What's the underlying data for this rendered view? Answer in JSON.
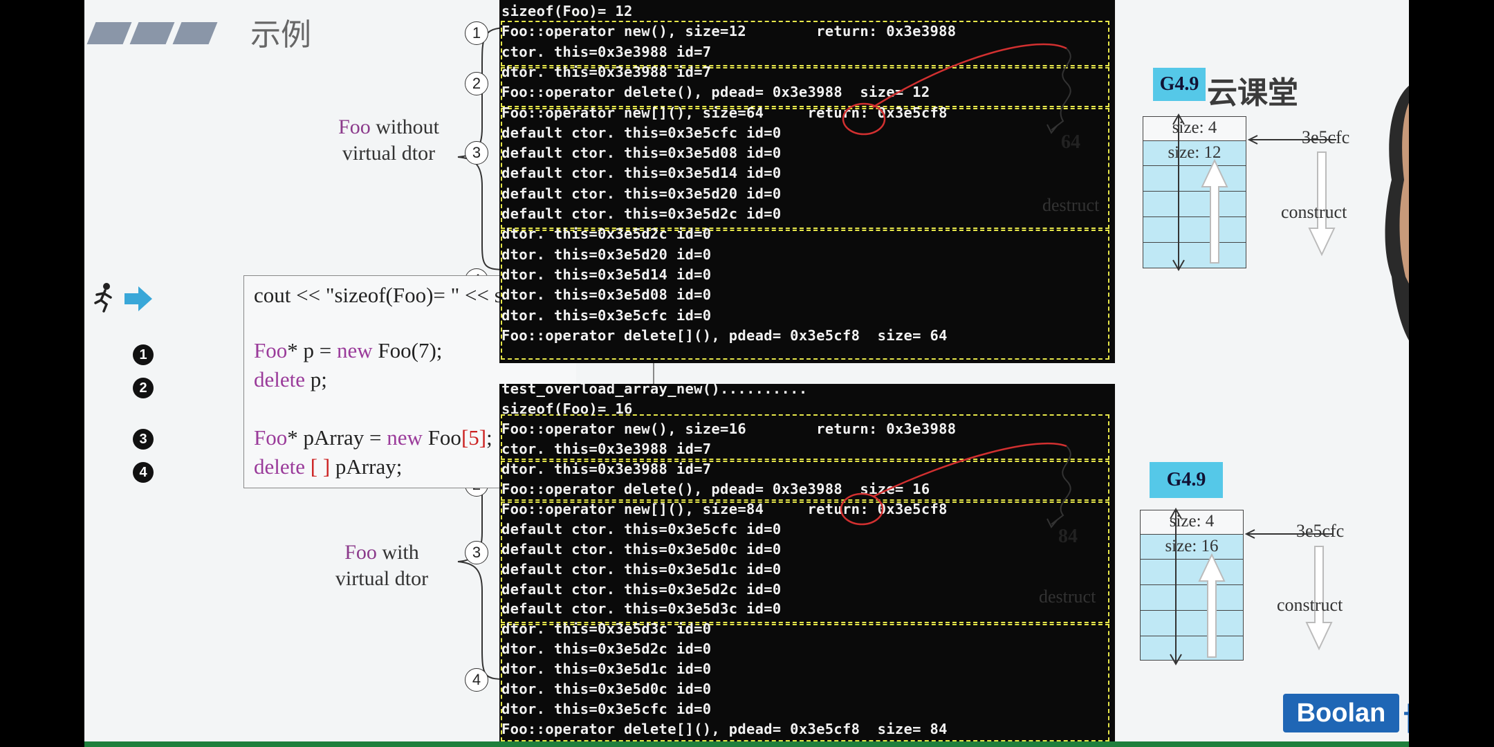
{
  "slide": {
    "title": "示例",
    "label_top": [
      "Foo",
      " without",
      "virtual dtor"
    ],
    "label_bottom": [
      "Foo",
      " with",
      "virtual dtor"
    ]
  },
  "code": {
    "line0": "cout << \"sizeof(Foo)= \" << sizeo",
    "line1": [
      "Foo",
      "* p = ",
      "new",
      " Foo(7);"
    ],
    "line2": [
      "delete",
      " p;"
    ],
    "line3": [
      "Foo",
      "* pArray = ",
      "new",
      " Foo",
      "[5]",
      ";"
    ],
    "line4": [
      "delete",
      " [ ] ",
      "pArray;"
    ],
    "bullets": [
      "1",
      "2",
      "3",
      "4"
    ]
  },
  "markers": [
    "1",
    "2",
    "3",
    "4"
  ],
  "terminal_top": {
    "lines": [
      "sizeof(Foo)= 12",
      "Foo::operator new(), size=12        return: 0x3e3988",
      "ctor. this=0x3e3988 id=7",
      "dtor. this=0x3e3988 id=7",
      "Foo::operator delete(), pdead= 0x3e3988  size= 12",
      "Foo::operator new[](), size=64     return: 0x3e5cf8",
      "default ctor. this=0x3e5cfc id=0",
      "default ctor. this=0x3e5d08 id=0",
      "default ctor. this=0x3e5d14 id=0",
      "default ctor. this=0x3e5d20 id=0",
      "default ctor. this=0x3e5d2c id=0",
      "dtor. this=0x3e5d2c id=0",
      "dtor. this=0x3e5d20 id=0",
      "dtor. this=0x3e5d14 id=0",
      "dtor. this=0x3e5d08 id=0",
      "dtor. this=0x3e5cfc id=0",
      "Foo::operator delete[](), pdead= 0x3e5cf8  size= 64"
    ]
  },
  "terminal_bottom": {
    "lines": [
      "test_overload_array_new()..........",
      "sizeof(Foo)= 16",
      "Foo::operator new(), size=16        return: 0x3e3988",
      "ctor. this=0x3e3988 id=7",
      "dtor. this=0x3e3988 id=7",
      "Foo::operator delete(), pdead= 0x3e3988  size= 16",
      "Foo::operator new[](), size=84     return: 0x3e5cf8",
      "default ctor. this=0x3e5cfc id=0",
      "default ctor. this=0x3e5d0c id=0",
      "default ctor. this=0x3e5d1c id=0",
      "default ctor. this=0x3e5d2c id=0",
      "default ctor. this=0x3e5d3c id=0",
      "dtor. this=0x3e5d3c id=0",
      "dtor. this=0x3e5d2c id=0",
      "dtor. this=0x3e5d1c id=0",
      "dtor. this=0x3e5d0c id=0",
      "dtor. this=0x3e5cfc id=0",
      "Foo::operator delete[](), pdead= 0x3e5cf8  size= 84"
    ]
  },
  "diagram_top": {
    "badge": "G4.9",
    "total": "64",
    "cell0": "size: 4",
    "cell1": "size: 12",
    "address": "3e5cfc",
    "destruct": "destruct",
    "construct": "construct"
  },
  "diagram_bottom": {
    "badge": "G4.9",
    "total": "84",
    "cell0": "size: 4",
    "cell1": "size: 16",
    "address": "3e5cfc",
    "destruct": "destruct",
    "construct": "construct"
  },
  "branding": {
    "yun": "云课堂",
    "boolan": "Boolan",
    "bolan_cn": "博览"
  },
  "colors": {
    "terminal_bg": "#0a0a0a",
    "dash": "#e8e84a",
    "cell_fill": "#bfe8f5",
    "badge": "#55c8e8",
    "keyword": "#9a3b9a",
    "annotation_red": "#d23030"
  }
}
